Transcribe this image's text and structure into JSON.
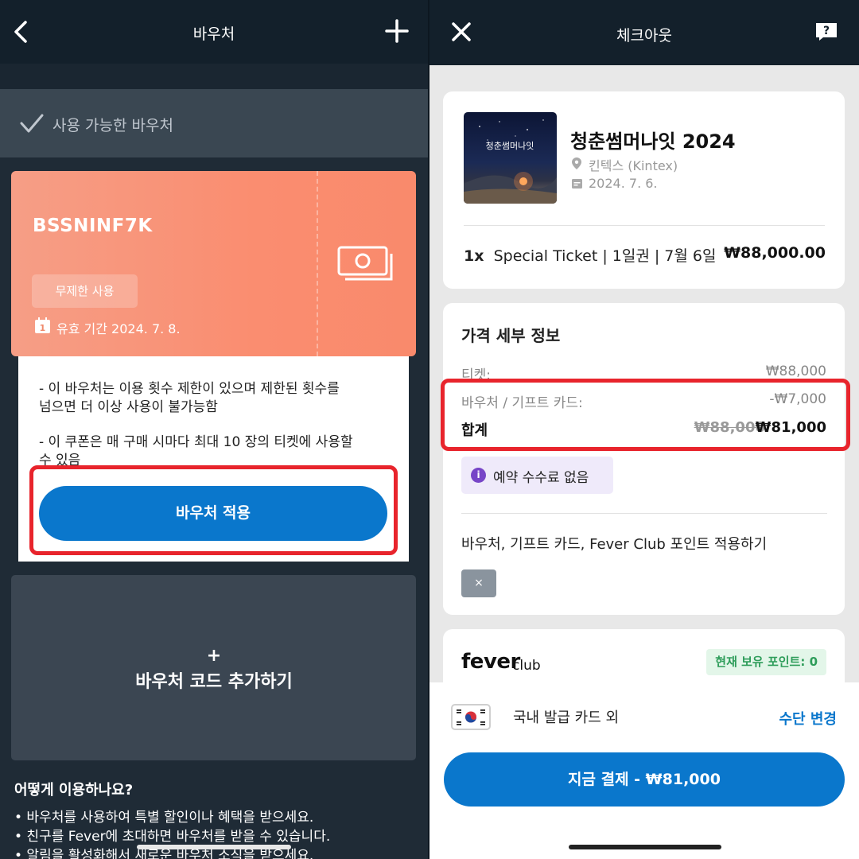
{
  "left": {
    "header_title": "바우처",
    "available_label": "사용 가능한 바우처",
    "voucher": {
      "code": "BSSNINF7K",
      "badge": "무제한 사용",
      "calendar_day": "1",
      "valid_until": "유효 기간 2024. 7. 8.",
      "desc_line1": "- 이 바우처는 이용 횟수 제한이 있으며 제한된 횟수를",
      "desc_line2": "넘으면 더 이상 사용이 불가능함",
      "desc_line3": "- 이 쿠폰은 매 구매 시마다  최대 10 장의 티켓에 사용할",
      "desc_line4": "수 있음",
      "apply_label": "바우처 적용"
    },
    "add_code": {
      "plus": "+",
      "label": "바우처 코드 추가하기"
    },
    "howto": {
      "title": "어떻게 이용하나요?",
      "items": [
        "• 바우처를 사용하여 특별 할인이나 혜택을 받으세요.",
        "• 친구를 Fever에 초대하면 바우처를 받을 수 있습니다.",
        "• 알림을 활성화해서 새로운 바우처 소식을 받으세요."
      ]
    },
    "colors": {
      "background": "#1f2b36",
      "voucher": "#fa8d70",
      "accent": "#0a77cc",
      "highlight": "#e8242c"
    }
  },
  "right": {
    "header_title": "체크아웃",
    "event": {
      "image_text": "청춘썸머나잇",
      "title": "청춘썸머나잇 2024",
      "venue": "킨텍스 (Kintex)",
      "date": "2024. 7. 6.",
      "ticket_qty": "1x",
      "ticket_desc": "Special Ticket | 1일권 | 7월 6일",
      "ticket_price": "₩88,000.00"
    },
    "price_details": {
      "title": "가격 세부 정보",
      "ticket_label": "티켓:",
      "ticket_value": "₩88,000",
      "voucher_label": "바우처 / 기프트 카드:",
      "voucher_value": "-₩7,000",
      "total_label": "합계",
      "total_old": "₩88,000",
      "total_new": "₩81,000",
      "fee_icon": "i",
      "fee_text": "예약 수수료 없음",
      "apply_all": "바우처, 기프트 카드, Fever Club 포인트 적용하기",
      "remove_chip": "×"
    },
    "fever_club": {
      "logo": "fever",
      "club": "club",
      "points": "현재 보유 포인트: 0"
    },
    "payment": {
      "method_label": "국내 발급 카드 외",
      "change_label": "수단 변경",
      "pay_button": "지금 결제 - ₩81,000"
    },
    "colors": {
      "accent": "#0a77cc",
      "points_green": "#2e9d5a",
      "fee_purple": "#7745c7"
    }
  }
}
